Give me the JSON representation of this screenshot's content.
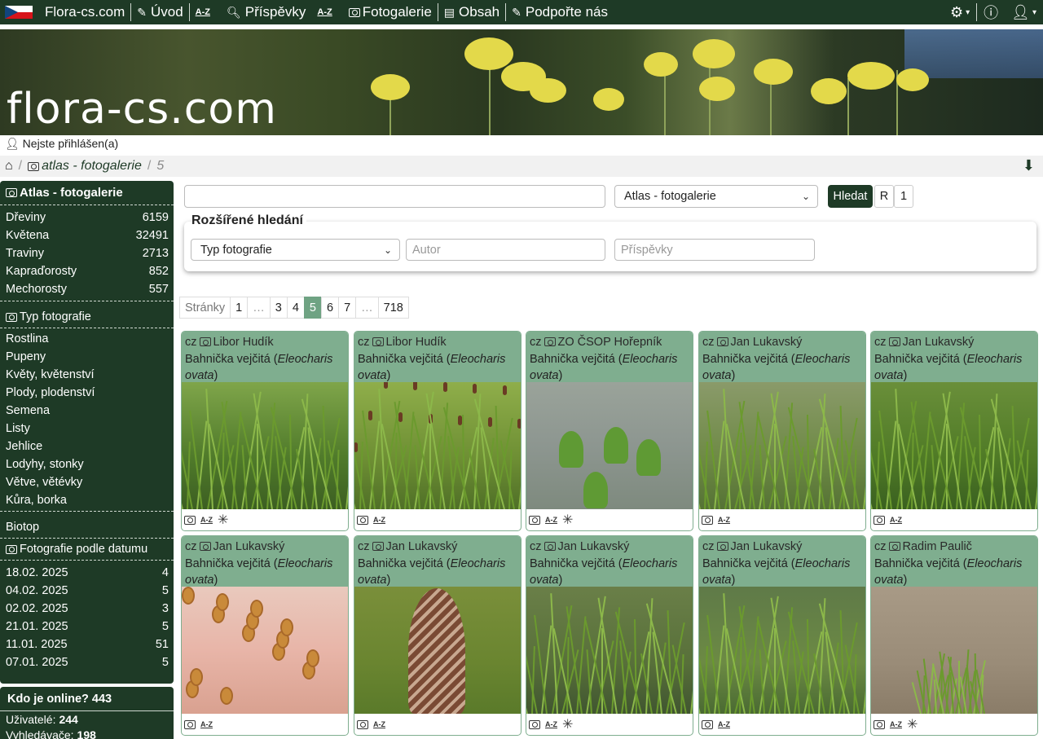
{
  "nav": {
    "site_name": "Flora-cs.com",
    "items": [
      {
        "label": "Úvod",
        "icon": "pencil-icon"
      },
      {
        "label": "Příspěvky",
        "icon": "search-posts-icon"
      },
      {
        "label": "Fotogalerie",
        "icon": "camera-icon"
      },
      {
        "label": "Obsah",
        "icon": "document-icon"
      },
      {
        "label": "Podpořte nás",
        "icon": "pencil-icon"
      }
    ]
  },
  "banner": {
    "logo_text": "flora-cs.com"
  },
  "login_status": "Nejste přihlášen(a)",
  "breadcrumb": {
    "section": "atlas - fotogalerie",
    "page": "5"
  },
  "sidebar": {
    "title": "Atlas - fotogalerie",
    "categories": [
      {
        "label": "Dřeviny",
        "count": "6159"
      },
      {
        "label": "Květena",
        "count": "32491"
      },
      {
        "label": "Traviny",
        "count": "2713"
      },
      {
        "label": "Kapraďorosty",
        "count": "852"
      },
      {
        "label": "Mechorosty",
        "count": "557"
      }
    ],
    "photo_type_title": "Typ fotografie",
    "photo_types": [
      "Rostlina",
      "Pupeny",
      "Květy, květenství",
      "Plody, plodenství",
      "Semena",
      "Listy",
      "Jehlice",
      "Lodyhy, stonky",
      "Větve, větévky",
      "Kůra, borka"
    ],
    "biotop": "Biotop",
    "by_date_title": "Fotografie podle datumu",
    "dates": [
      {
        "date": "18.02. 2025",
        "count": "4"
      },
      {
        "date": "04.02. 2025",
        "count": "5"
      },
      {
        "date": "02.02. 2025",
        "count": "3"
      },
      {
        "date": "21.01. 2025",
        "count": "5"
      },
      {
        "date": "11.01. 2025",
        "count": "51"
      },
      {
        "date": "07.01. 2025",
        "count": "5"
      }
    ]
  },
  "online": {
    "title": "Kdo je online? 443",
    "users_label": "Uživatelé:",
    "users": "244",
    "bots_label": "Vyhledávače:",
    "bots": "198"
  },
  "search": {
    "query": "",
    "scope": "Atlas - fotogalerie",
    "button": "Hledat",
    "btn_r": "R",
    "btn_1": "1",
    "advanced_title": "Rozšířené hledání",
    "photo_type": "Typ fotografie",
    "author_placeholder": "Autor",
    "posts_placeholder": "Příspěvky"
  },
  "pager": {
    "label": "Stránky",
    "pages": [
      "1",
      "…",
      "3",
      "4",
      "5",
      "6",
      "7",
      "…",
      "718"
    ],
    "current": "5"
  },
  "cards": [
    {
      "lang": "cz",
      "author": "Libor Hudík",
      "name": "Bahnička vejčitá",
      "latin1": "Eleocharis",
      "latin2": "ovata",
      "star": true
    },
    {
      "lang": "cz",
      "author": "Libor Hudík",
      "name": "Bahnička vejčitá",
      "latin1": "Eleocharis",
      "latin2": "ovata",
      "star": false
    },
    {
      "lang": "cz",
      "author": "ZO ČSOP Hořepník",
      "name": "Bahnička vejčitá",
      "latin1": "Eleocharis",
      "latin2": "ovata",
      "star": true
    },
    {
      "lang": "cz",
      "author": "Jan Lukavský",
      "name": "Bahnička vejčitá",
      "latin1": "Eleocharis",
      "latin2": "ovata",
      "star": false
    },
    {
      "lang": "cz",
      "author": "Jan Lukavský",
      "name": "Bahnička vejčitá",
      "latin1": "Eleocharis",
      "latin2": "ovata",
      "star": false
    },
    {
      "lang": "cz",
      "author": "Jan Lukavský",
      "name": "Bahnička vejčitá",
      "latin1": "Eleocharis",
      "latin2": "ovata",
      "star": false
    },
    {
      "lang": "cz",
      "author": "Jan Lukavský",
      "name": "Bahnička vejčitá",
      "latin1": "Eleocharis",
      "latin2": "ovata",
      "star": false
    },
    {
      "lang": "cz",
      "author": "Jan Lukavský",
      "name": "Bahnička vejčitá",
      "latin1": "Eleocharis",
      "latin2": "ovata",
      "star": true
    },
    {
      "lang": "cz",
      "author": "Jan Lukavský",
      "name": "Bahnička vejčitá",
      "latin1": "Eleocharis",
      "latin2": "ovata",
      "star": false
    },
    {
      "lang": "cz",
      "author": "Radim Paulič",
      "name": "Bahnička vejčitá",
      "latin1": "Eleocharis",
      "latin2": "ovata",
      "star": true
    }
  ],
  "colors": {
    "brand_dark": "#1e3a26",
    "card_head": "#7fae8f",
    "pager_active": "#6fa383"
  }
}
